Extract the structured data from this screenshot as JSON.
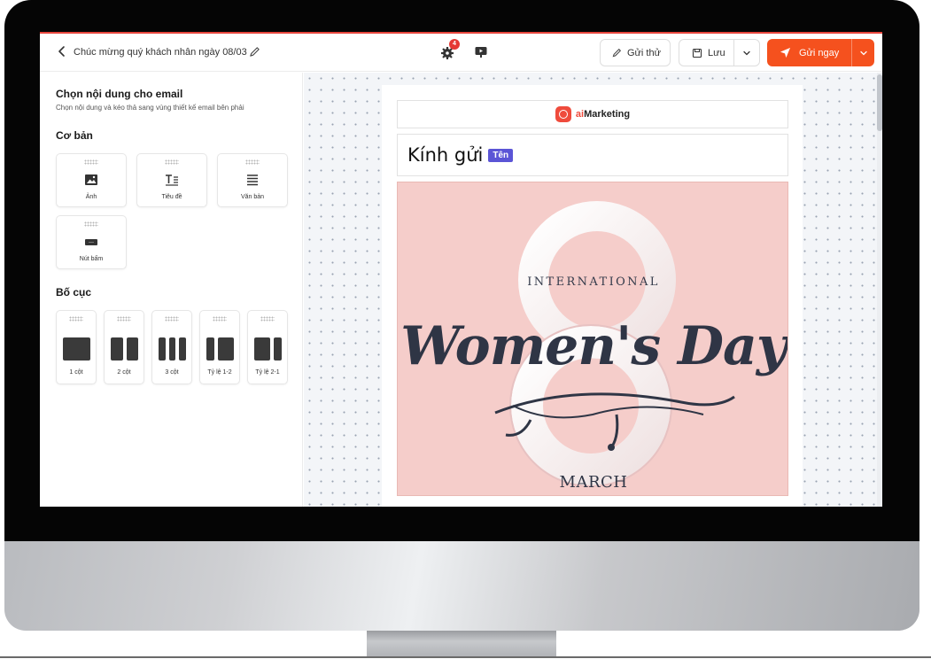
{
  "header": {
    "title": "Chúc mừng quý khách nhân ngày 08/03",
    "notification_count": "4",
    "test_label": "Gửi thử",
    "save_label": "Lưu",
    "send_label": "Gửi ngay"
  },
  "sidebar": {
    "title": "Chọn nội dung cho email",
    "subtitle": "Chọn nội dung và kéo thả sang vùng thiết kế email bên phải",
    "basic_heading": "Cơ bản",
    "basic_blocks": [
      {
        "label": "Ảnh",
        "icon": "image-icon"
      },
      {
        "label": "Tiêu đề",
        "icon": "heading-icon"
      },
      {
        "label": "Văn bản",
        "icon": "text-icon"
      },
      {
        "label": "Nút bấm",
        "icon": "button-icon"
      }
    ],
    "layout_heading": "Bố cục",
    "layouts": [
      {
        "label": "1 cột"
      },
      {
        "label": "2 cột"
      },
      {
        "label": "3 cột"
      },
      {
        "label": "Tỷ lệ 1-2"
      },
      {
        "label": "Tỷ lệ 2-1"
      }
    ]
  },
  "email": {
    "brand_ai": "ai",
    "brand_name": "Marketing",
    "greeting": "Kính gửi",
    "name_tag": "Tên",
    "hero_top": "INTERNATIONAL",
    "hero_main": "Women's Day",
    "hero_bottom": "MARCH"
  },
  "colors": {
    "accent": "#f5511e",
    "brand": "#ef4b3c",
    "tag": "#5b55d6",
    "hero_bg": "#f5cdca"
  }
}
